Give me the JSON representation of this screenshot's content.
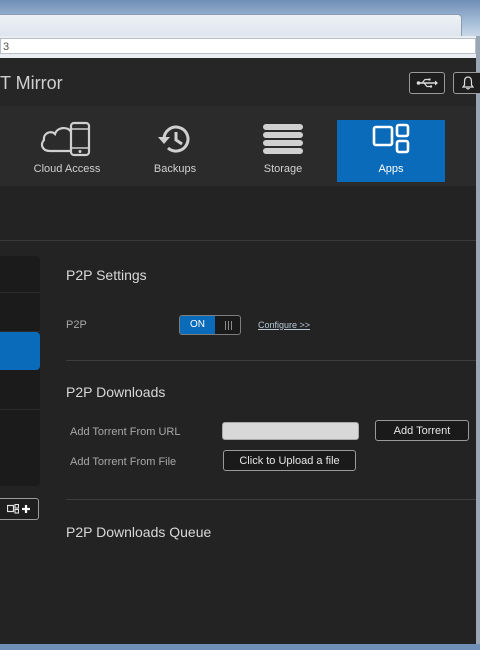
{
  "browser": {
    "address_fragment": "3"
  },
  "header": {
    "app_title": "T Mirror",
    "usb_icon": "usb-icon",
    "bell_icon": "bell-icon"
  },
  "nav": {
    "items": [
      {
        "label": "Cloud Access",
        "icon": "cloud-access-icon"
      },
      {
        "label": "Backups",
        "icon": "backups-icon"
      },
      {
        "label": "Storage",
        "icon": "storage-icon"
      },
      {
        "label": "Apps",
        "icon": "apps-icon",
        "active": true
      }
    ]
  },
  "p2p_settings": {
    "title": "P2P Settings",
    "p2p_label": "P2P",
    "toggle_on_label": "ON",
    "configure_link": "Configure >>"
  },
  "p2p_downloads": {
    "title": "P2P Downloads",
    "url_label": "Add Torrent From URL",
    "url_value": "",
    "add_torrent_button": "Add Torrent",
    "file_label": "Add Torrent From File",
    "upload_button": "Click to Upload a file"
  },
  "queue": {
    "title": "P2P Downloads Queue"
  },
  "colors": {
    "accent": "#0a6bba",
    "background": "#232323"
  }
}
